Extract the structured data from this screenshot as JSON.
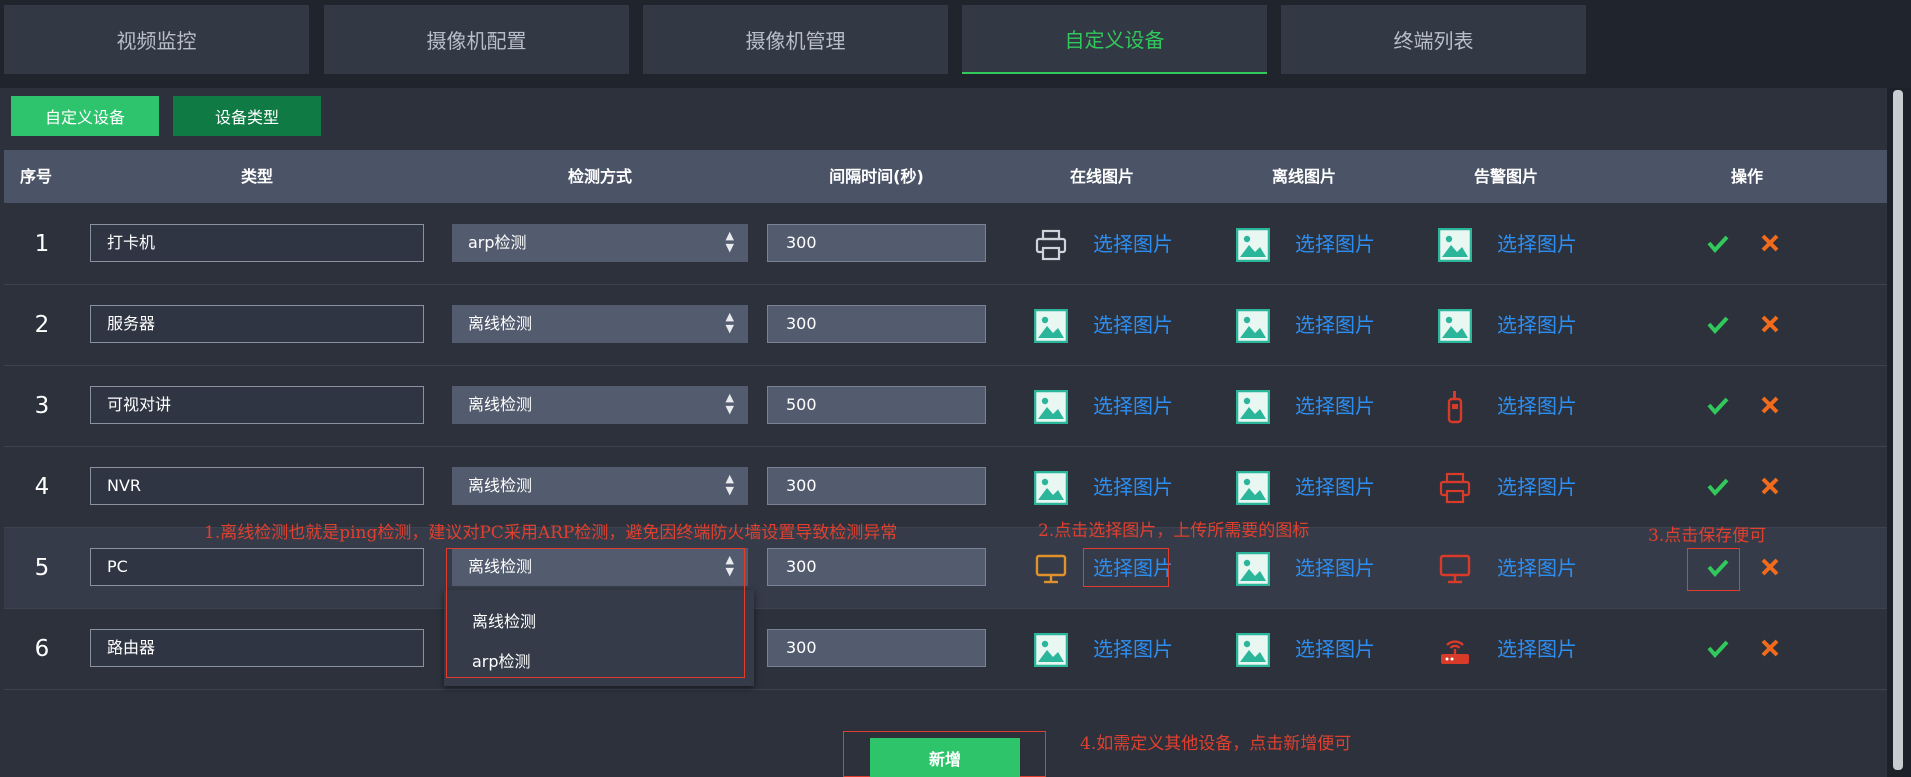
{
  "tabs": [
    "视频监控",
    "摄像机配置",
    "摄像机管理",
    "自定义设备",
    "终端列表"
  ],
  "subtabs": [
    "自定义设备",
    "设备类型"
  ],
  "colors": {
    "accent_green": "#31c85c",
    "link_blue": "#2d8ef2",
    "annotation_red": "#e0402f",
    "cancel_orange": "#f26b1d"
  },
  "table": {
    "headers": [
      "序号",
      "类型",
      "检测方式",
      "间隔时间(秒)",
      "在线图片",
      "离线图片",
      "告警图片",
      "操作"
    ],
    "pick_label": "选择图片",
    "rows": [
      {
        "idx": "1",
        "type": "打卡机",
        "method": "arp检测",
        "interval": "300",
        "icons": [
          "printer-icon",
          "image-icon",
          "image-icon"
        ]
      },
      {
        "idx": "2",
        "type": "服务器",
        "method": "离线检测",
        "interval": "300",
        "icons": [
          "image-icon",
          "image-icon",
          "image-icon"
        ]
      },
      {
        "idx": "3",
        "type": "可视对讲",
        "method": "离线检测",
        "interval": "500",
        "icons": [
          "image-icon",
          "image-icon",
          "walkie-talkie-icon"
        ]
      },
      {
        "idx": "4",
        "type": "NVR",
        "method": "离线检测",
        "interval": "300",
        "icons": [
          "image-icon",
          "image-icon",
          "printer-icon"
        ]
      },
      {
        "idx": "5",
        "type": "PC",
        "method": "离线检测",
        "interval": "300",
        "icons": [
          "monitor-icon",
          "image-icon",
          "monitor-icon"
        ]
      },
      {
        "idx": "6",
        "type": "路由器",
        "method": "离线检测",
        "interval": "300",
        "icons": [
          "image-icon",
          "image-icon",
          "router-icon"
        ]
      }
    ]
  },
  "dropdown_options": [
    "离线检测",
    "arp检测"
  ],
  "add_button": "新增",
  "annotations": {
    "note1": "1.离线检测也就是ping检测，建议对PC采用ARP检测，避免因终端防火墙设置导致检测异常",
    "note2": "2.点击选择图片，上传所需要的图标",
    "note3": "3.点击保存便可",
    "note4": "4.如需定义其他设备，点击新增便可"
  }
}
